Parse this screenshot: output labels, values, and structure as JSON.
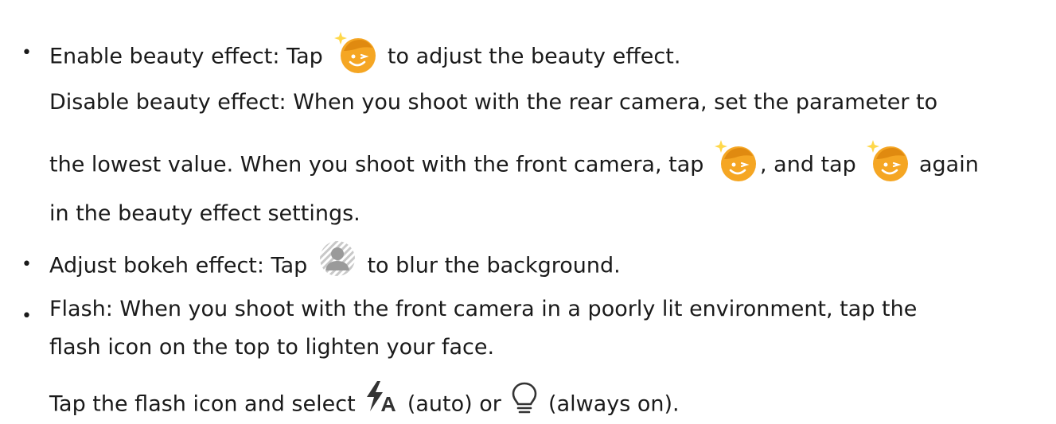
{
  "bullet_char": "•",
  "items": [
    {
      "lines": [
        {
          "before": "Enable beauty effect: Tap ",
          "icon1": "beauty-face-icon",
          "after": " to adjust the beauty effect."
        },
        {
          "text": "Disable beauty effect: When you shoot with the rear camera, set the parameter to"
        },
        {
          "before": "the lowest value. When you shoot with the front camera, tap ",
          "icon1": "beauty-face-icon",
          "middle": ", and tap ",
          "icon2": "beauty-face-icon",
          "after": " again"
        },
        {
          "text": "in the beauty effect settings."
        }
      ]
    },
    {
      "lines": [
        {
          "before": "Adjust bokeh effect: Tap ",
          "icon1": "bokeh-portrait-icon",
          "after": " to blur the background."
        }
      ]
    },
    {
      "lines": [
        {
          "text": "Flash: When you shoot with the front camera in a poorly lit environment, tap the"
        },
        {
          "text": "flash icon on the top to lighten your face."
        },
        {
          "before": "Tap the flash icon and select ",
          "icon1": "flash-auto-icon",
          "middle": " (auto) or ",
          "icon2": "bulb-always-on-icon",
          "after": " (always on)."
        }
      ]
    }
  ],
  "colors": {
    "text": "#1a1a1a",
    "beauty_icon": "#f5a623",
    "beauty_sparkle": "#ffd84a",
    "bokeh_icon": "#9a9a9a",
    "flash_icon": "#333333"
  }
}
